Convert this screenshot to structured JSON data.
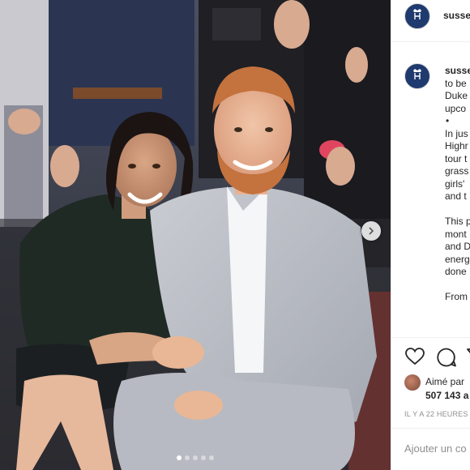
{
  "post": {
    "username": "sussexroyal",
    "photo_alt": "",
    "carousel_dot_count": 5,
    "carousel_active_index": 0
  },
  "caption": {
    "lines": [
      "sussexroyal",
      "to be",
      "Duke",
      "upco",
      "•",
      "In jus",
      "Highr",
      "tour t",
      "grass",
      "girls'",
      "and t",
      "",
      "This p",
      "mont",
      "and D",
      "energ",
      "done",
      "",
      "From"
    ]
  },
  "engagement": {
    "liked_by_text": "Aimé par",
    "likes_count": "507 143 a",
    "timestamp": "IL Y A 22 HEURES"
  },
  "comment": {
    "placeholder": "Ajouter un co"
  },
  "icons": {
    "like": "heart-icon",
    "comment": "comment-icon",
    "share": "share-icon",
    "next": "chevron-right-icon",
    "avatar": "royal-cypher-logo"
  }
}
